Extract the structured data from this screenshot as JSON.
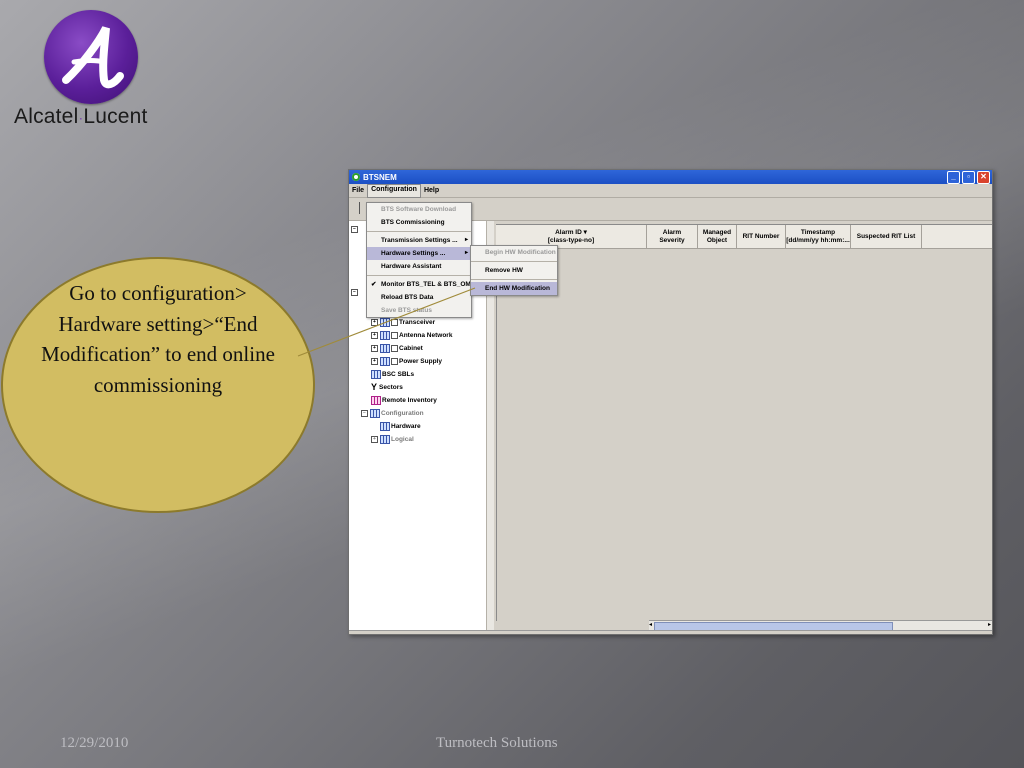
{
  "brand": {
    "name_left": "Alcatel",
    "name_right": "Lucent"
  },
  "window": {
    "title": "BTSNEM",
    "menus": [
      "File",
      "Configuration",
      "Help"
    ],
    "table_headers": [
      {
        "line1": "Alarm ID",
        "line2": "[class-type-no]"
      },
      {
        "line1": "Alarm",
        "line2": "Severity"
      },
      {
        "line1": "Managed",
        "line2": "Object"
      },
      {
        "line1": "RIT Number",
        "line2": ""
      },
      {
        "line1": "Timestamp",
        "line2": "[dd/mm/yy hh:mm:..."
      },
      {
        "line1": "Suspected RIT List",
        "line2": ""
      }
    ]
  },
  "config_menu": [
    {
      "label": "BTS Software Download",
      "disabled": true
    },
    {
      "label": "BTS Commissioning",
      "disabled": false
    },
    {
      "label": "Transmission Settings ...",
      "submenu": true
    },
    {
      "label": "Hardware Settings ...",
      "submenu": true,
      "highlighted": true
    },
    {
      "label": "Hardware Assistant"
    },
    {
      "label": "Monitor BTS_TEL & BTS_OM",
      "checked": true
    },
    {
      "label": "Reload BTS Data"
    },
    {
      "label": "Save BTS status",
      "disabled": true
    }
  ],
  "hardware_submenu": [
    {
      "label": "Begin HW Modification",
      "disabled": true
    },
    {
      "label": "Remove HW"
    },
    {
      "label": "End HW Modification",
      "highlighted": true
    }
  ],
  "tree": [
    "Transceiver",
    "Antenna Network",
    "Cabinet",
    "Power Supply",
    "BSC SBLs",
    "Sectors",
    "Remote Inventory",
    "Configuration",
    "Hardware",
    "Logical"
  ],
  "callout": {
    "text": "Go to configuration> Hardware setting>“End Modification” to end online commissioning"
  },
  "footer": {
    "date": "12/29/2010",
    "company": "Turnotech Solutions"
  }
}
